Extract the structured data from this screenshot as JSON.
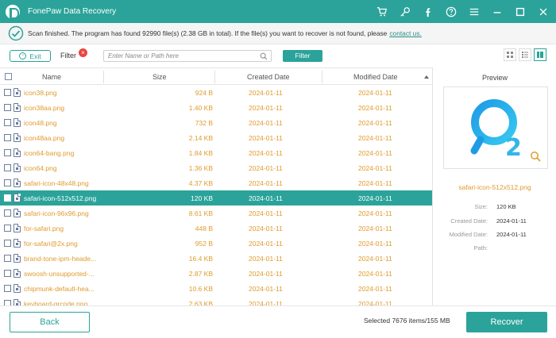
{
  "app": {
    "title": "FonePaw Data Recovery"
  },
  "colors": {
    "accent": "#2ba39a",
    "file_name": "#e09b2d",
    "filter_badge": "#e9463f"
  },
  "titlebar_icons": [
    "cart-icon",
    "key-icon",
    "facebook-icon",
    "help-icon",
    "menu-icon",
    "minimize-icon",
    "maximize-icon",
    "close-icon"
  ],
  "status": {
    "message": "Scan finished. The program has found 92990 file(s) (2.38 GB in total). If the file(s) you want to recover is not found, please",
    "link": "contact us."
  },
  "toolbar": {
    "exit_label": "Exit",
    "filter_label": "Filter",
    "filter_badge": "×",
    "search_placeholder": "Enter Name or Path here",
    "filter_button": "Filter"
  },
  "table": {
    "columns": {
      "name": "Name",
      "size": "Size",
      "created": "Created Date",
      "modified": "Modified Date"
    },
    "sort": "Modified Date ascending",
    "rows": [
      {
        "name": "icon38.png",
        "size": "924  B",
        "created": "2024-01-11",
        "modified": "2024-01-11"
      },
      {
        "name": "icon38aa.png",
        "size": "1.40 KB",
        "created": "2024-01-11",
        "modified": "2024-01-11"
      },
      {
        "name": "icon48.png",
        "size": "732  B",
        "created": "2024-01-11",
        "modified": "2024-01-11"
      },
      {
        "name": "icon48aa.png",
        "size": "2.14 KB",
        "created": "2024-01-11",
        "modified": "2024-01-11"
      },
      {
        "name": "icon64-bang.png",
        "size": "1.84 KB",
        "created": "2024-01-11",
        "modified": "2024-01-11"
      },
      {
        "name": "icon64.png",
        "size": "1.36 KB",
        "created": "2024-01-11",
        "modified": "2024-01-11"
      },
      {
        "name": "safari-icon-48x48.png",
        "size": "4.37 KB",
        "created": "2024-01-11",
        "modified": "2024-01-11"
      },
      {
        "name": "safari-icon-512x512.png",
        "size": "120 KB",
        "created": "2024-01-11",
        "modified": "2024-01-11",
        "selected": true
      },
      {
        "name": "safari-icon-96x96.png",
        "size": "8.61 KB",
        "created": "2024-01-11",
        "modified": "2024-01-11"
      },
      {
        "name": "for-safari.png",
        "size": "448  B",
        "created": "2024-01-11",
        "modified": "2024-01-11"
      },
      {
        "name": "for-safari@2x.png",
        "size": "952  B",
        "created": "2024-01-11",
        "modified": "2024-01-11"
      },
      {
        "name": "brand-tone-ipm-heade...",
        "size": "16.4 KB",
        "created": "2024-01-11",
        "modified": "2024-01-11"
      },
      {
        "name": "swoosh-unsupported-...",
        "size": "2.87 KB",
        "created": "2024-01-11",
        "modified": "2024-01-11"
      },
      {
        "name": "chipmunk-default-hea...",
        "size": "10.6 KB",
        "created": "2024-01-11",
        "modified": "2024-01-11"
      },
      {
        "name": "keyboard-qrcode.png",
        "size": "2.63 KB",
        "created": "2024-01-11",
        "modified": "2024-01-11"
      }
    ]
  },
  "preview": {
    "title": "Preview",
    "file_name": "safari-icon-512x512.png",
    "image_icon": "q2-app-logo-icon",
    "meta": [
      {
        "label": "Size:",
        "value": "120 KB"
      },
      {
        "label": "Created Date:",
        "value": "2024-01-11"
      },
      {
        "label": "Modified Date:",
        "value": "2024-01-11"
      },
      {
        "label": "Path:",
        "value": ""
      }
    ]
  },
  "footer": {
    "back_label": "Back",
    "selected_info": "Selected 7676 items/155 MB",
    "recover_label": "Recover"
  }
}
